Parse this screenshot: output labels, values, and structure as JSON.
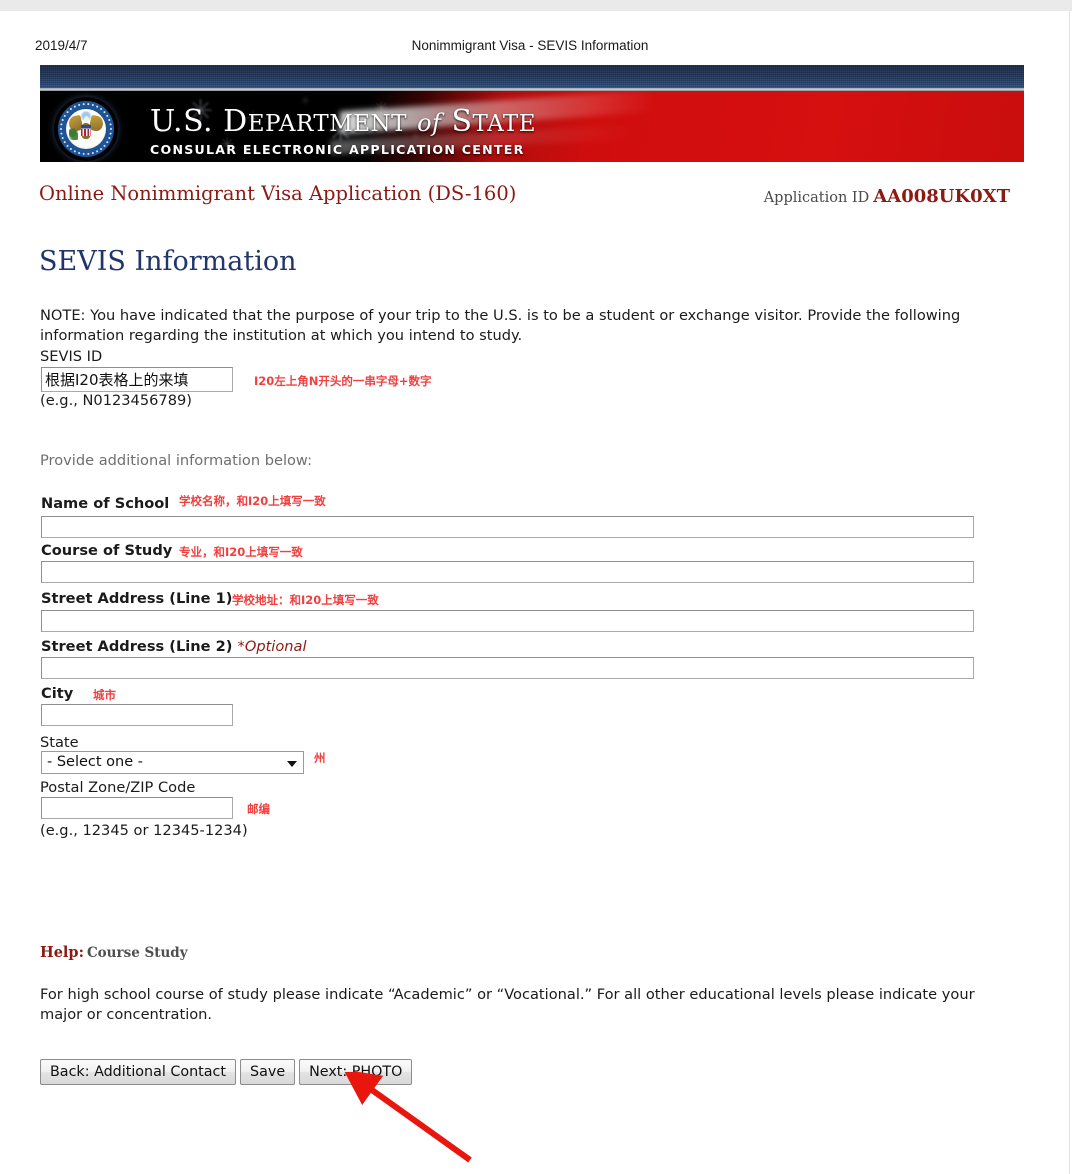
{
  "print_header": {
    "date": "2019/4/7",
    "title": "Nonimmigrant Visa - SEVIS Information"
  },
  "banner": {
    "org_us": "U.S.",
    "org_department": "D",
    "org_department_rest": "EPARTMENT",
    "org_of": "of",
    "org_state": "S",
    "org_state_rest": "TATE",
    "line1_full": "U.S. DEPARTMENT of STATE",
    "subtitle": "CONSULAR ELECTRONIC APPLICATION CENTER",
    "seal_alt": "great-seal-of-the-united-states"
  },
  "app_header": {
    "title": "Online Nonimmigrant Visa Application (DS-160)",
    "application_id_label": "Application ID",
    "application_id_value": "AA008UK0XT"
  },
  "page": {
    "heading": "SEVIS Information",
    "note": "NOTE: You have indicated that the purpose of your trip to the U.S. is to be a student or exchange visitor. Provide the following information regarding the institution at which you intend to study.",
    "provide_additional": "Provide additional information below:"
  },
  "fields": {
    "sevis_id": {
      "label": "SEVIS ID",
      "value": "根据I20表格上的来填",
      "annotation": "I20左上角N开头的一串字母+数字",
      "example": "(e.g., N0123456789)"
    },
    "school_name": {
      "label": "Name of School",
      "value": "",
      "annotation": "学校名称，和I20上填写一致"
    },
    "course_of_study": {
      "label": "Course of Study",
      "value": "",
      "annotation": "专业，和I20上填写一致"
    },
    "street1": {
      "label": "Street Address (Line 1)",
      "value": "",
      "annotation": "学校地址：和I20上填写一致"
    },
    "street2": {
      "label": "Street Address (Line 2)",
      "optional": "*Optional",
      "value": "",
      "annotation": ""
    },
    "city": {
      "label": "City",
      "value": "",
      "annotation": "城市"
    },
    "state": {
      "label": "State",
      "value": "- Select one -",
      "annotation": "州",
      "caret_icon": "chevron-down-icon"
    },
    "postal": {
      "label": "Postal Zone/ZIP Code",
      "value": "",
      "annotation": "邮编",
      "example": "(e.g., 12345 or 12345-1234)"
    }
  },
  "help": {
    "label": "Help:",
    "topic": "Course Study",
    "body": "For high school course of study please indicate “Academic” or “Vocational.” For all other educational levels please indicate your major or concentration."
  },
  "buttons": {
    "back": "Back: Additional Contact",
    "save": "Save",
    "next": "Next: PHOTO"
  },
  "annotation_arrow": {
    "color": "#e8160c",
    "points_to": "next-photo-button"
  },
  "colors": {
    "title_red": "#8b1a12",
    "heading_blue": "#21356b",
    "annotation_red": "#f04040",
    "banner_navy": "#1b3052",
    "banner_red": "#d00d0d"
  }
}
